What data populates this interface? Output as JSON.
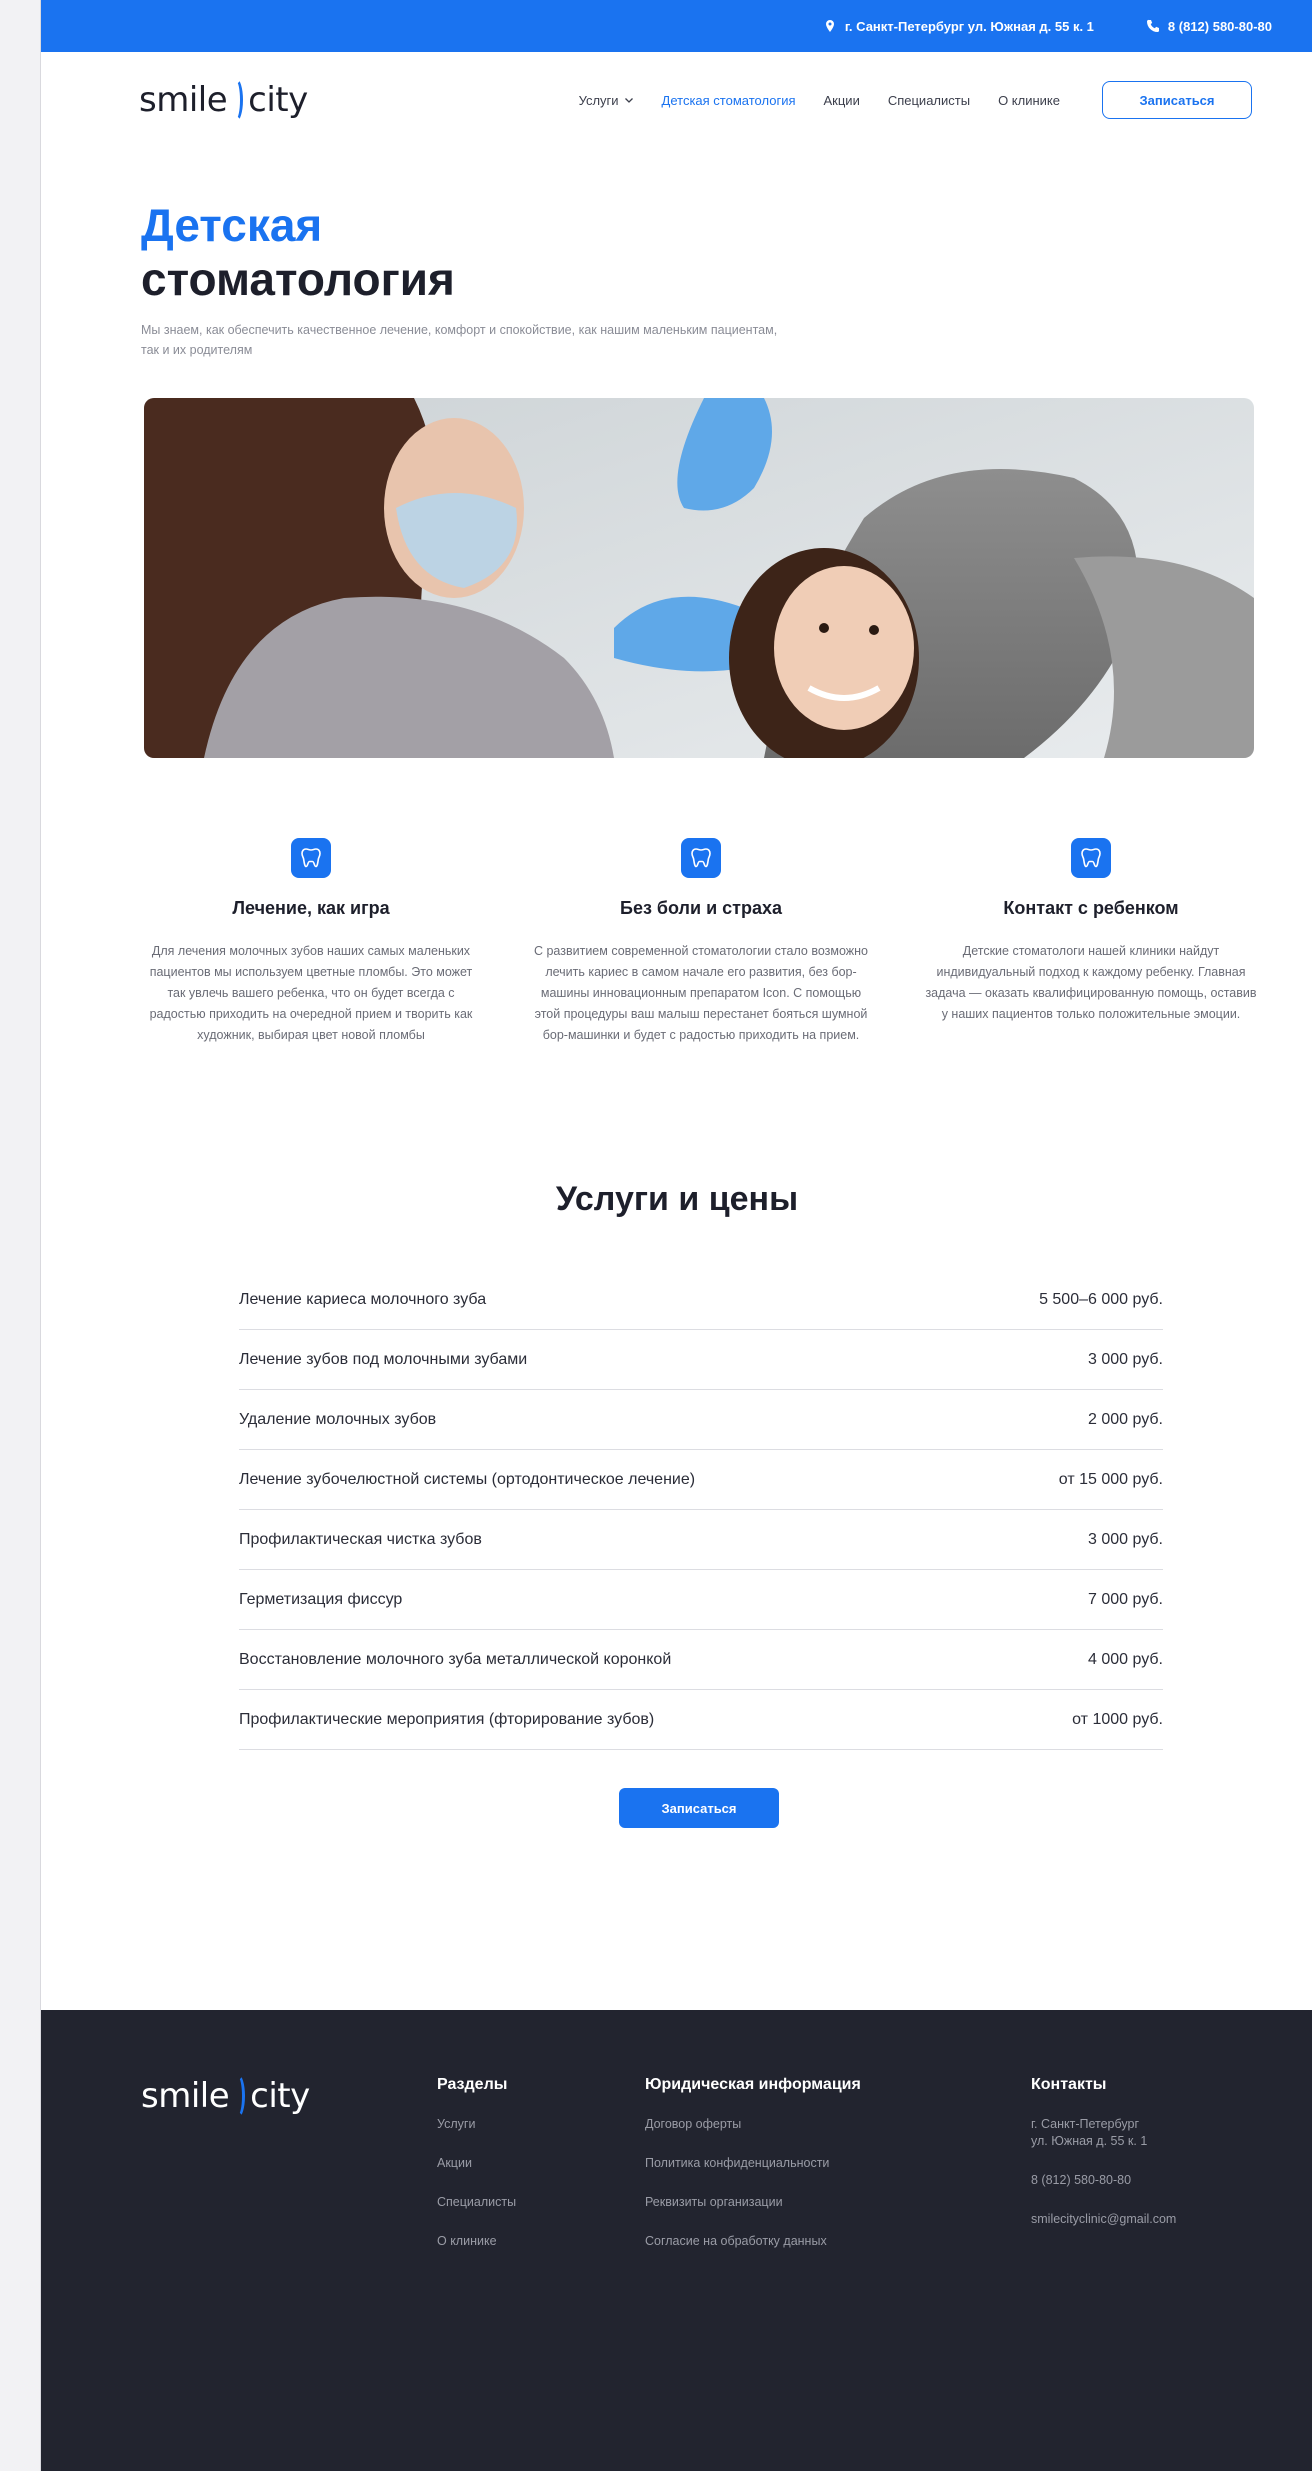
{
  "topbar": {
    "address": "г. Санкт-Петербург ул. Южная д. 55 к. 1",
    "phone": "8 (812) 580-80-80"
  },
  "logo": {
    "left": "smile",
    "right": "city"
  },
  "nav": {
    "items": [
      {
        "label": "Услуги",
        "has_dropdown": true,
        "active": false
      },
      {
        "label": "Детская стоматология",
        "active": true
      },
      {
        "label": "Акции",
        "active": false
      },
      {
        "label": "Специалисты",
        "active": false
      },
      {
        "label": "О клинике",
        "active": false
      }
    ],
    "cta": "Записаться"
  },
  "hero": {
    "title_line1": "Детская",
    "title_line2": "стоматология",
    "subtitle": "Мы знаем, как обеспечить качественное лечение, комфорт и спокойствие, как нашим маленьким пациентам, так и их родителям"
  },
  "features": [
    {
      "icon": "tooth-icon",
      "title": "Лечение, как игра",
      "text": "Для лечения молочных зубов наших самых маленьких пациентов мы используем цветные пломбы. Это может так увлечь вашего ребенка, что он будет всегда с радостью приходить на очередной прием и творить как художник, выбирая цвет новой пломбы"
    },
    {
      "icon": "tooth-icon",
      "title": "Без боли и страха",
      "text": "С развитием современной стоматологии стало возможно лечить кариес в самом начале его развития, без бор-машины инновационным препаратом Icon. С помощью этой процедуры ваш малыш перестанет бояться шумной бор-машинки и будет с радостью приходить на прием."
    },
    {
      "icon": "tooth-icon",
      "title": "Контакт с ребенком",
      "text": "Детские стоматологи нашей клиники найдут индивидуальный подход к каждому ребенку. Главная задача — оказать квалифицированную помощь, оставив у наших пациентов только положительные эмоции."
    }
  ],
  "prices": {
    "title": "Услуги и цены",
    "rows": [
      {
        "service": "Лечение кариеса молочного зуба",
        "price": "5 500–6 000 руб."
      },
      {
        "service": "Лечение зубов под молочными зубами",
        "price": "3 000 руб."
      },
      {
        "service": "Удаление молочных зубов",
        "price": "2 000 руб."
      },
      {
        "service": "Лечение зубочелюстной системы (ортодонтическое лечение)",
        "price": "от 15 000 руб."
      },
      {
        "service": "Профилактическая чистка зубов",
        "price": "3 000 руб."
      },
      {
        "service": "Герметизация фиссур",
        "price": "7 000 руб."
      },
      {
        "service": "Восстановление молочного зуба металлической коронкой",
        "price": "4 000 руб."
      },
      {
        "service": "Профилактические мероприятия (фторирование зубов)",
        "price": "от 1000 руб."
      }
    ],
    "cta": "Записаться"
  },
  "footer": {
    "sections": {
      "title": "Разделы",
      "items": [
        "Услуги",
        "Акции",
        "Специалисты",
        "О клинике"
      ]
    },
    "legal": {
      "title": "Юридическая информация",
      "items": [
        "Договор оферты",
        "Политика конфиденциальности",
        "Реквизиты организации",
        "Согласие на обработку данных"
      ]
    },
    "contacts": {
      "title": "Контакты",
      "address_line1": "г. Санкт-Петербург",
      "address_line2": "ул. Южная д. 55 к. 1",
      "phone": "8 (812) 580-80-80",
      "email": "smilecityclinic@gmail.com"
    }
  },
  "colors": {
    "accent": "#1a73f0",
    "footer_bg": "#22242f",
    "text_dark": "#1d1f2b",
    "text_muted": "#8a8c96"
  }
}
